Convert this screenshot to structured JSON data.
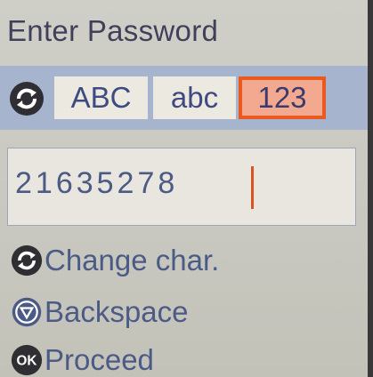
{
  "title": "Enter Password",
  "modes": {
    "upper_label": "ABC",
    "lower_label": "abc",
    "numeric_label": "123",
    "selected": "123",
    "toggle_icon": "rotate-arrows-icon"
  },
  "input": {
    "value": "21635278"
  },
  "hints": [
    {
      "icon": "rotate-arrows-icon",
      "label": "Change char."
    },
    {
      "icon": "triangle-button-icon",
      "label": "Backspace"
    },
    {
      "icon": "ok-button-icon",
      "label": "Proceed"
    }
  ],
  "colors": {
    "background": "#c9c9c1",
    "mode_bar": "#a6b4cd",
    "selected_border": "#ea5a1f",
    "selected_fill": "#f2a98f",
    "text": "#4b5b86",
    "title": "#40405a"
  }
}
